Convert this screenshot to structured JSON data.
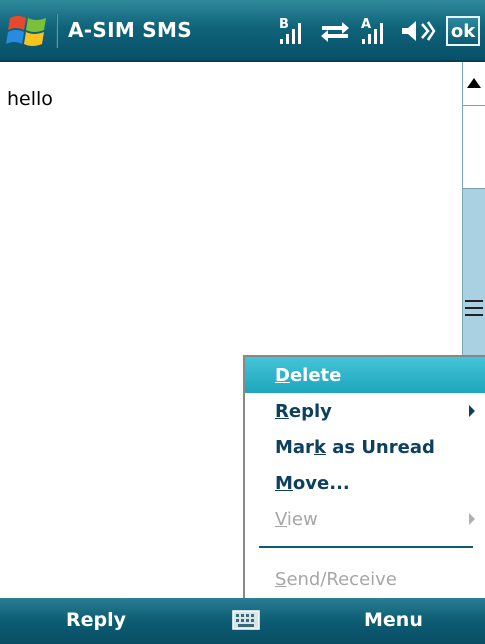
{
  "title_bar": {
    "app_title": "A-SIM SMS",
    "ok_label": "ok",
    "icons": [
      "windows-start-icon",
      "signal-b-icon",
      "data-sync-icon",
      "signal-a-icon",
      "volume-icon"
    ],
    "signal_b_label": "B",
    "signal_a_label": "A"
  },
  "message": {
    "body": "hello"
  },
  "context_menu": {
    "items": [
      {
        "before": "",
        "accel": "D",
        "after": "elete",
        "state": "selected",
        "submenu": false
      },
      {
        "before": "",
        "accel": "R",
        "after": "eply",
        "state": "normal",
        "submenu": true
      },
      {
        "before": "Mar",
        "accel": "k",
        "after": " as Unread",
        "state": "normal",
        "submenu": false
      },
      {
        "before": "",
        "accel": "M",
        "after": "ove...",
        "state": "normal",
        "submenu": false
      },
      {
        "before": "",
        "accel": "V",
        "after": "iew",
        "state": "disabled",
        "submenu": true
      },
      {
        "before": "",
        "accel": "S",
        "after": "end/Receive",
        "state": "disabled",
        "submenu": false
      }
    ]
  },
  "bottom_bar": {
    "left_softkey": "Reply",
    "right_softkey": "Menu"
  },
  "colors": {
    "title_bar": "#0f6479",
    "menu_highlight": "#2fb5cb",
    "menu_text": "#0d3f60",
    "disabled_text": "#a6a6a6",
    "scrollbar_track": "#a9d1e2"
  }
}
